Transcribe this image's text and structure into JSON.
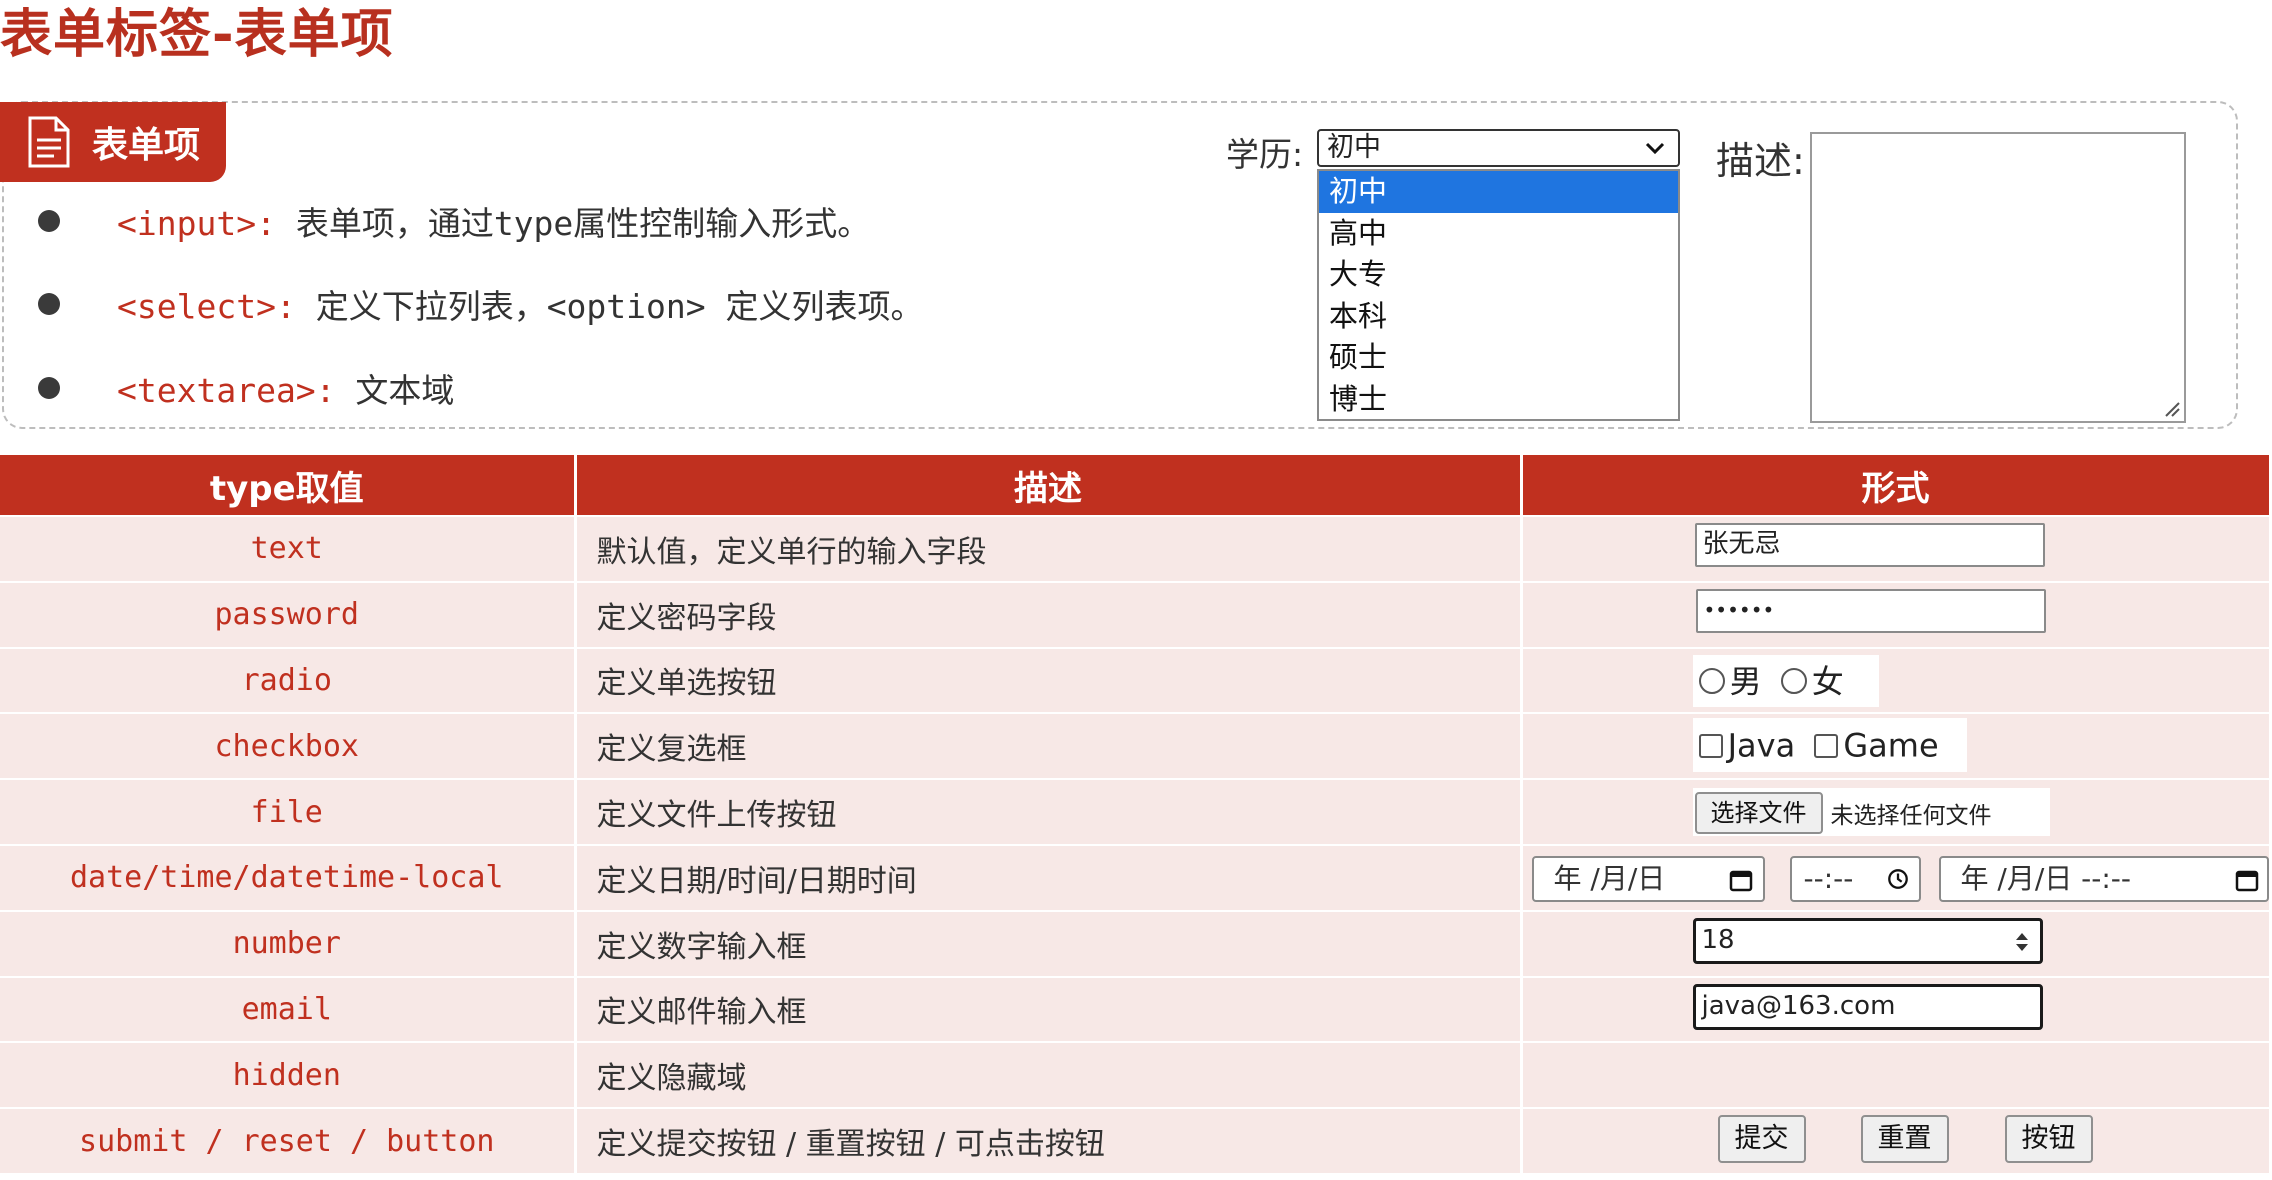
{
  "page_title": "表单标签-表单项",
  "badge": {
    "label": "表单项",
    "icon": "document-icon"
  },
  "bullets": [
    {
      "tag": "<input>: ",
      "text": "表单项，通过type属性控制输入形式。"
    },
    {
      "tag": "<select>: ",
      "text": "定义下拉列表，<option> 定义列表项。"
    },
    {
      "tag": "<textarea>: ",
      "text": "文本域"
    }
  ],
  "demo": {
    "select_label": "学历:",
    "select_value": "初中",
    "options": [
      "初中",
      "高中",
      "大专",
      "本科",
      "硕士",
      "博士"
    ],
    "selected_index": 0,
    "textarea_label": "描述:"
  },
  "table": {
    "headers": [
      "type取值",
      "描述",
      "形式"
    ],
    "rows": [
      {
        "type": "text",
        "desc": "默认值，定义单行的输入字段"
      },
      {
        "type": "password",
        "desc": "定义密码字段"
      },
      {
        "type": "radio",
        "desc": "定义单选按钮"
      },
      {
        "type": "checkbox",
        "desc": "定义复选框"
      },
      {
        "type": "file",
        "desc": "定义文件上传按钮"
      },
      {
        "type": "date/time/datetime-local",
        "desc": "定义日期/时间/日期时间"
      },
      {
        "type": "number",
        "desc": "定义数字输入框"
      },
      {
        "type": "email",
        "desc": "定义邮件输入框"
      },
      {
        "type": "hidden",
        "desc": "定义隐藏域"
      },
      {
        "type": "submit / reset / button",
        "desc": "定义提交按钮 / 重置按钮 / 可点击按钮"
      }
    ]
  },
  "controls": {
    "text_value": "张无忌",
    "password_value": "••••••",
    "radio_male": "男",
    "radio_female": "女",
    "check_java": "Java",
    "check_game": "Game",
    "file_button": "选择文件",
    "file_status": "未选择任何文件",
    "date_placeholder": "年 /月/日",
    "time_placeholder": "--:--",
    "datetime_placeholder": "年 /月/日 --:--",
    "number_value": "18",
    "email_value": "java@163.com",
    "submit_label": "提交",
    "reset_label": "重置",
    "button_label": "按钮"
  },
  "colors": {
    "accent": "#c0301f",
    "row_bg": "#f7e8e6",
    "select_highlight": "#1f75e0"
  }
}
